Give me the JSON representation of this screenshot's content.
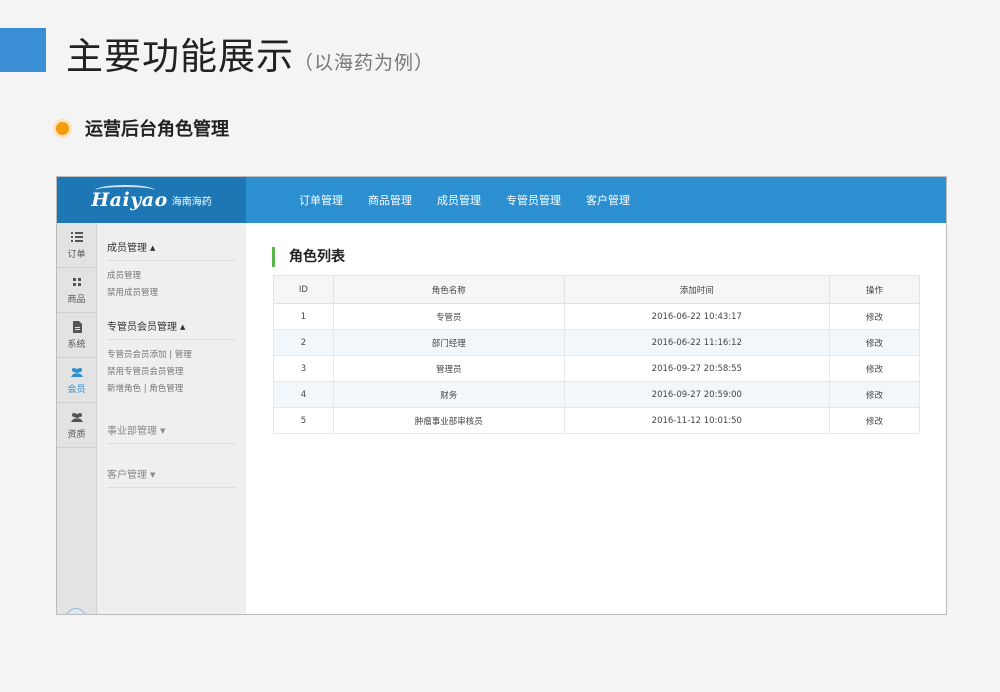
{
  "slide": {
    "title": "主要功能展示",
    "subtitle": "（以海药为例）",
    "section_label": "运营后台角色管理"
  },
  "app": {
    "logo": {
      "brand": "Haiyao",
      "cn": "海南海药"
    },
    "nav": [
      "订单管理",
      "商品管理",
      "成员管理",
      "专管员管理",
      "客户管理"
    ],
    "rail": [
      {
        "label": "订单",
        "icon": "list-icon"
      },
      {
        "label": "商品",
        "icon": "grid-icon"
      },
      {
        "label": "系统",
        "icon": "document-icon"
      },
      {
        "label": "会员",
        "icon": "users-icon",
        "active": true
      },
      {
        "label": "资质",
        "icon": "users-icon"
      }
    ],
    "menu": {
      "g1": {
        "title": "成员管理",
        "items": [
          "成员管理",
          "禁用成员管理"
        ]
      },
      "g2": {
        "title": "专管员会员管理",
        "items": [
          "专管员会员添加 | 管理",
          "禁用专管员会员管理",
          "新增角色 | 角色管理"
        ]
      },
      "g3": {
        "title": "事业部管理"
      },
      "g4": {
        "title": "客户管理"
      }
    },
    "panel_title": "角色列表",
    "table": {
      "headers": [
        "ID",
        "角色名称",
        "添加时间",
        "操作"
      ],
      "rows": [
        {
          "id": "1",
          "name": "专管员",
          "time": "2016-06-22 10:43:17",
          "op": "修改"
        },
        {
          "id": "2",
          "name": "部门经理",
          "time": "2016-06-22 11:16:12",
          "op": "修改"
        },
        {
          "id": "3",
          "name": "管理员",
          "time": "2016-09-27 20:58:55",
          "op": "修改"
        },
        {
          "id": "4",
          "name": "财务",
          "time": "2016-09-27 20:59:00",
          "op": "修改"
        },
        {
          "id": "5",
          "name": "肿瘤事业部审核员",
          "time": "2016-11-12 10:01:50",
          "op": "修改"
        }
      ]
    }
  },
  "colors": {
    "accent": "#3a8fd4",
    "topbar": "#2b8fd0",
    "logo_bg": "#1d77b4",
    "bullet": "#f39c12",
    "panel_bar": "#5ab44a"
  }
}
